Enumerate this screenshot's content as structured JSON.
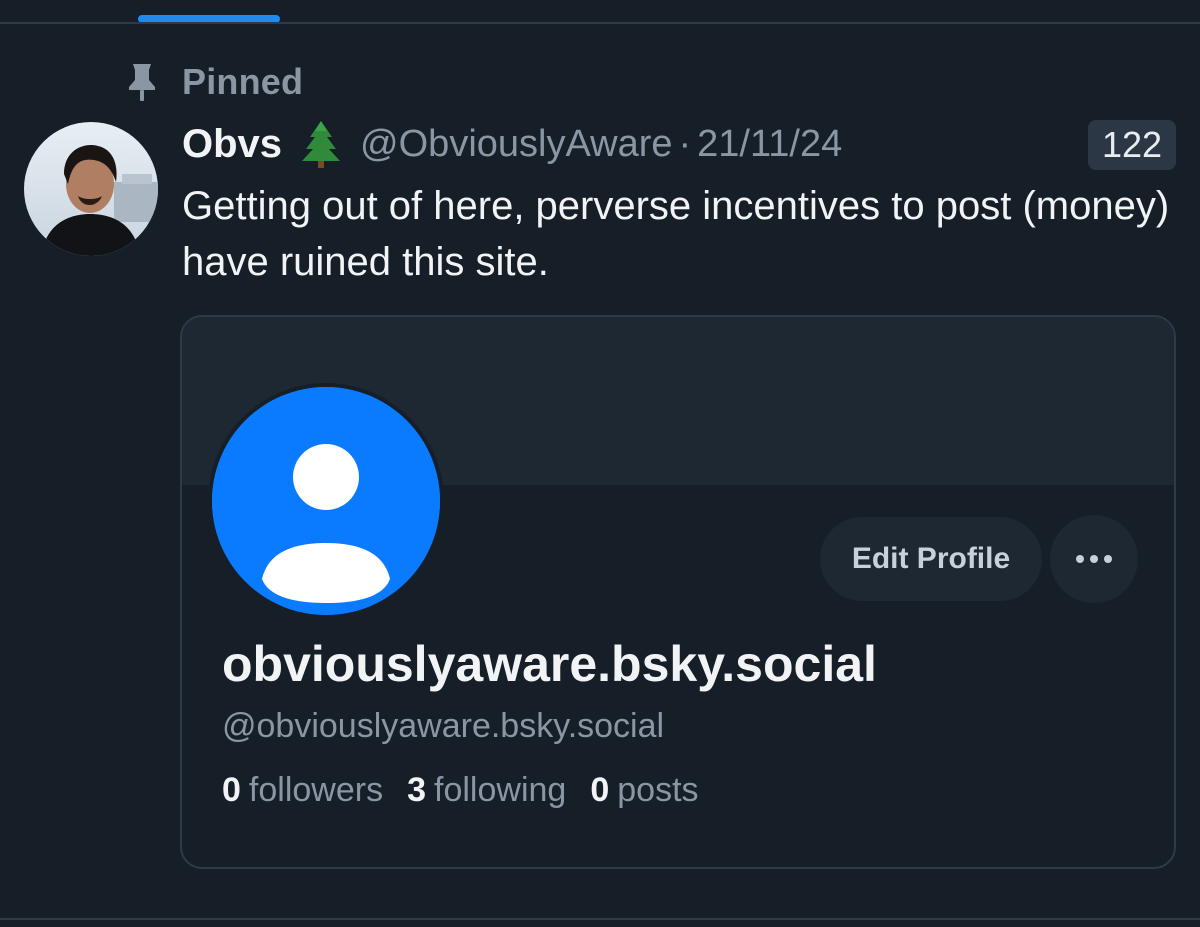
{
  "pinned": {
    "label": "Pinned",
    "icon": "pin-icon"
  },
  "post": {
    "author": {
      "display_name": "Obvs",
      "emoji_icon": "christmas-tree-icon",
      "handle": "@ObviouslyAware",
      "separator": "·",
      "date": "21/11/24"
    },
    "count_badge": "122",
    "text": "Getting out of here, perverse incentives to post (money) have ruined this site."
  },
  "embed": {
    "edit_profile_label": "Edit Profile",
    "more_icon": "more-dots-icon",
    "profile_name": "obviouslyaware.bsky.social",
    "profile_handle": "@obviouslyaware.bsky.social",
    "stats": [
      {
        "value": "0",
        "label": "followers"
      },
      {
        "value": "3",
        "label": "following"
      },
      {
        "value": "0",
        "label": "posts"
      }
    ]
  },
  "colors": {
    "background": "#161e27",
    "accent": "#1d8cf0",
    "default_avatar": "#0a7aff",
    "muted_text": "#8a96a4"
  }
}
